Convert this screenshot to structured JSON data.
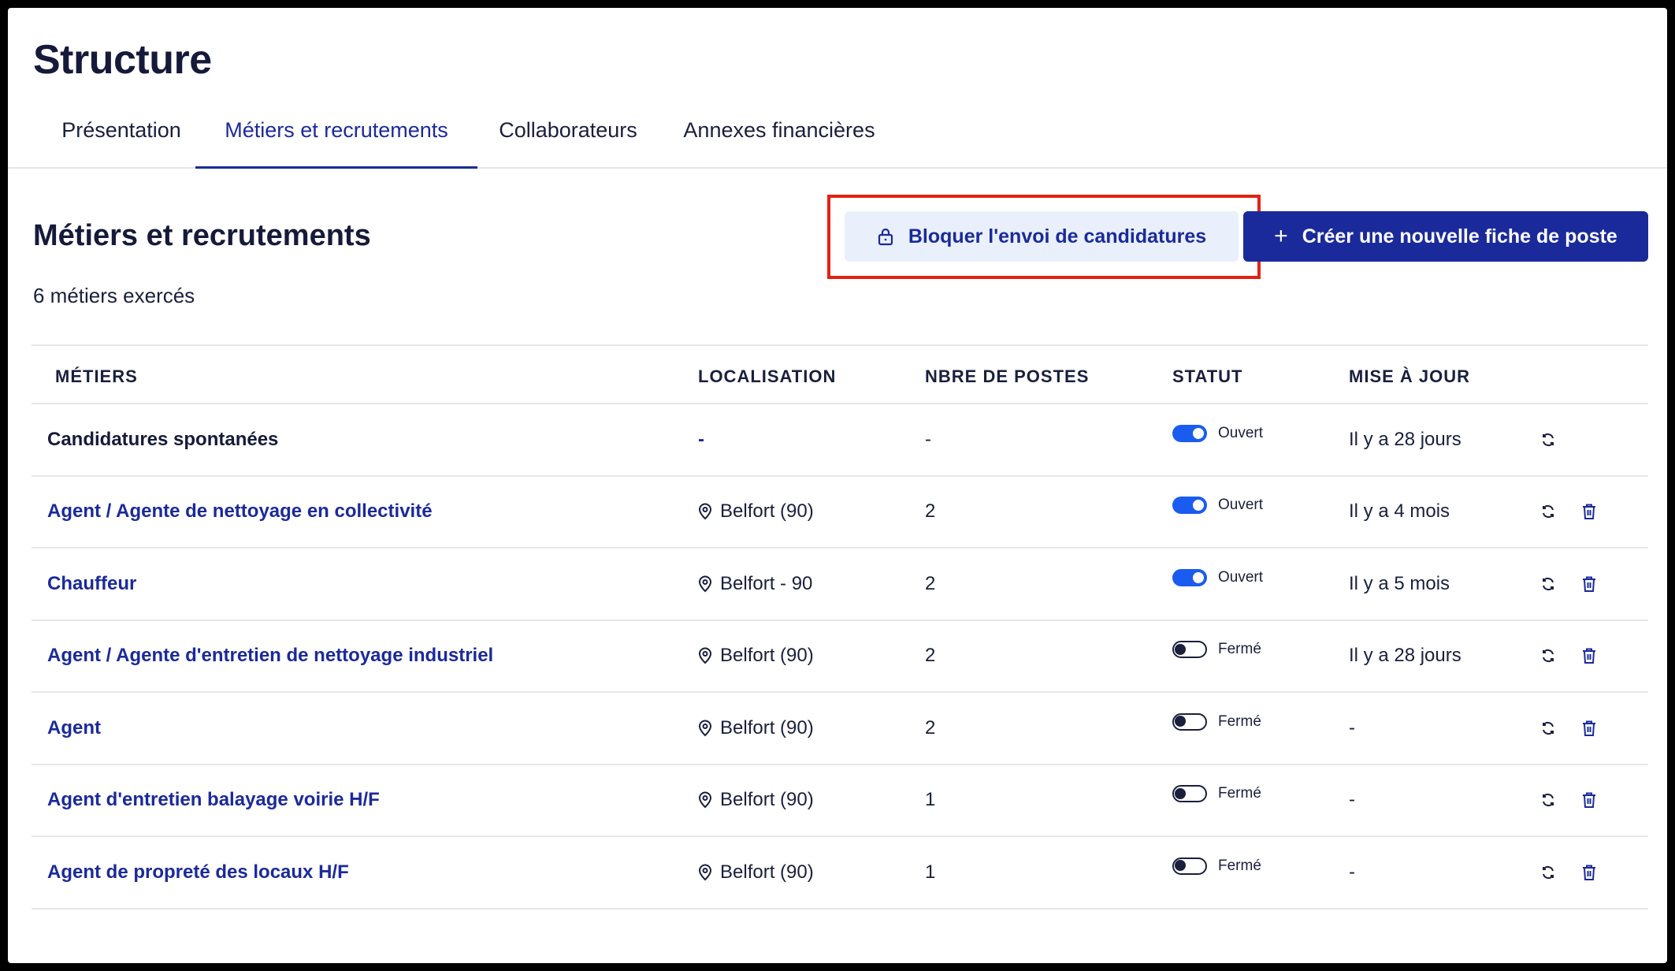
{
  "page": {
    "title": "Structure",
    "tabs": [
      {
        "label": "Présentation",
        "active": false
      },
      {
        "label": "Métiers et recrutements",
        "active": true
      },
      {
        "label": "Collaborateurs",
        "active": false
      },
      {
        "label": "Annexes financières",
        "active": false
      }
    ]
  },
  "section": {
    "title": "Métiers et recrutements",
    "count_text": "6 métiers exercés",
    "block_button_label": "Bloquer l'envoi de candidatures",
    "create_button_label": "Créer une nouvelle fiche de poste"
  },
  "table": {
    "headers": [
      "MÉTIERS",
      "LOCALISATION",
      "NBRE DE POSTES",
      "STATUT",
      "MISE À JOUR"
    ],
    "rows": [
      {
        "metier": "Candidatures spontanées",
        "localisation": "-",
        "postes": "-",
        "statut": "Ouvert",
        "ouvert": true,
        "maj": "Il y a 28 jours",
        "deletable": false
      },
      {
        "metier": "Agent / Agente de nettoyage en collectivité",
        "localisation": "Belfort (90)",
        "postes": "2",
        "statut": "Ouvert",
        "ouvert": true,
        "maj": "Il y a 4 mois",
        "deletable": true
      },
      {
        "metier": "Chauffeur",
        "localisation": "Belfort - 90",
        "postes": "2",
        "statut": "Ouvert",
        "ouvert": true,
        "maj": "Il y a 5 mois",
        "deletable": true
      },
      {
        "metier": "Agent / Agente d'entretien de nettoyage industriel",
        "localisation": "Belfort (90)",
        "postes": "2",
        "statut": "Fermé",
        "ouvert": false,
        "maj": "Il y a 28 jours",
        "deletable": true
      },
      {
        "metier": "Agent",
        "localisation": "Belfort (90)",
        "postes": "2",
        "statut": "Fermé",
        "ouvert": false,
        "maj": "-",
        "deletable": true
      },
      {
        "metier": "Agent d'entretien balayage voirie H/F",
        "localisation": "Belfort (90)",
        "postes": "1",
        "statut": "Fermé",
        "ouvert": false,
        "maj": "-",
        "deletable": true
      },
      {
        "metier": "Agent de propreté des locaux H/F",
        "localisation": "Belfort (90)",
        "postes": "1",
        "statut": "Fermé",
        "ouvert": false,
        "maj": "-",
        "deletable": true
      }
    ]
  },
  "colors": {
    "primary": "#1b2a9a",
    "toggle_on": "#1b5cf0",
    "highlight": "#e32213",
    "text": "#1a1f3d"
  }
}
